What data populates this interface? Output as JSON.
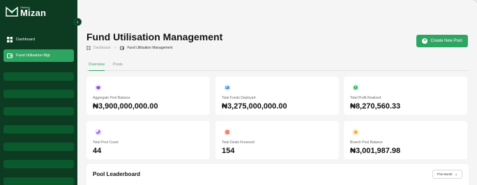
{
  "sidebar": {
    "brand_small": "Sterling",
    "brand_name": "Mizan",
    "items": [
      {
        "label": "Dashboard",
        "icon": "grid-icon"
      },
      {
        "label": "Fund Utilisation Mgt",
        "icon": "wallet-icon",
        "active": true
      }
    ],
    "placeholder_count": 7
  },
  "header": {
    "title": "Fund Utilisation Management",
    "breadcrumb": [
      "Dashboard",
      "Fund Utilisation Management"
    ],
    "create_button": "Create New Pool"
  },
  "tabs": [
    "Overview",
    "Pools"
  ],
  "cards": [
    {
      "label": "Aggregate Pool Balance",
      "value": "₦3,900,000,000.00",
      "icon": "pool-icon",
      "color": "#8a4bd6"
    },
    {
      "label": "Total Funds Deployed",
      "value": "₦3,275,000,000.00",
      "icon": "deploy-icon",
      "color": "#3b8ee0"
    },
    {
      "label": "Total Profit Realized",
      "value": "₦8,270,560.33",
      "icon": "profit-icon",
      "color": "#2fa562"
    },
    {
      "label": "Total Pool Count",
      "value": "44",
      "icon": "count-icon",
      "color": "#8a4bd6"
    },
    {
      "label": "Total Deals Financed",
      "value": "154",
      "icon": "deals-icon",
      "color": "#e8553b"
    },
    {
      "label": "Branch Pool Balance",
      "value": "₦3,001,987.98",
      "icon": "branch-icon",
      "color": "#f2b134"
    }
  ],
  "leaderboard": {
    "title": "Pool Leaderboard",
    "period": "This Month"
  },
  "colors": {
    "sidebar_bg": "#0d3b22",
    "accent": "#2fa562",
    "placeholder": "#0a5a2e"
  }
}
